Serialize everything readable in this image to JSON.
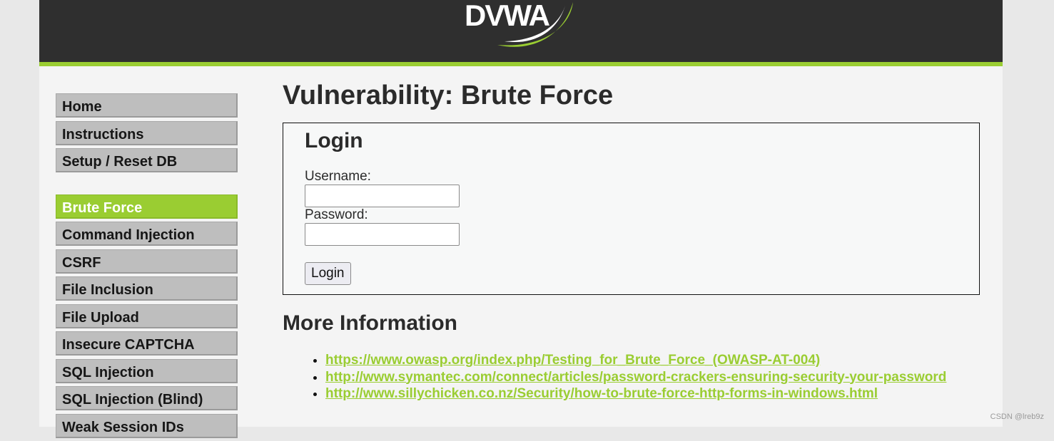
{
  "header": {
    "logo_text": "DVWA",
    "accent_color": "#9acd32",
    "background_color": "#2f2f2f"
  },
  "sidebar": {
    "groups": [
      {
        "items": [
          {
            "label": "Home",
            "selected": false
          },
          {
            "label": "Instructions",
            "selected": false
          },
          {
            "label": "Setup / Reset DB",
            "selected": false
          }
        ]
      },
      {
        "items": [
          {
            "label": "Brute Force",
            "selected": true
          },
          {
            "label": "Command Injection",
            "selected": false
          },
          {
            "label": "CSRF",
            "selected": false
          },
          {
            "label": "File Inclusion",
            "selected": false
          },
          {
            "label": "File Upload",
            "selected": false
          },
          {
            "label": "Insecure CAPTCHA",
            "selected": false
          },
          {
            "label": "SQL Injection",
            "selected": false
          },
          {
            "label": "SQL Injection (Blind)",
            "selected": false
          },
          {
            "label": "Weak Session IDs",
            "selected": false
          }
        ]
      }
    ]
  },
  "main": {
    "title": "Vulnerability: Brute Force",
    "login_form": {
      "heading": "Login",
      "username_label": "Username:",
      "username_value": "",
      "password_label": "Password:",
      "password_value": "",
      "submit_label": "Login"
    },
    "more_info": {
      "title": "More Information",
      "links": [
        "https://www.owasp.org/index.php/Testing_for_Brute_Force_(OWASP-AT-004)",
        "http://www.symantec.com/connect/articles/password-crackers-ensuring-security-your-password",
        "http://www.sillychicken.co.nz/Security/how-to-brute-force-http-forms-in-windows.html"
      ]
    }
  },
  "watermark": "CSDN @lreb9z"
}
